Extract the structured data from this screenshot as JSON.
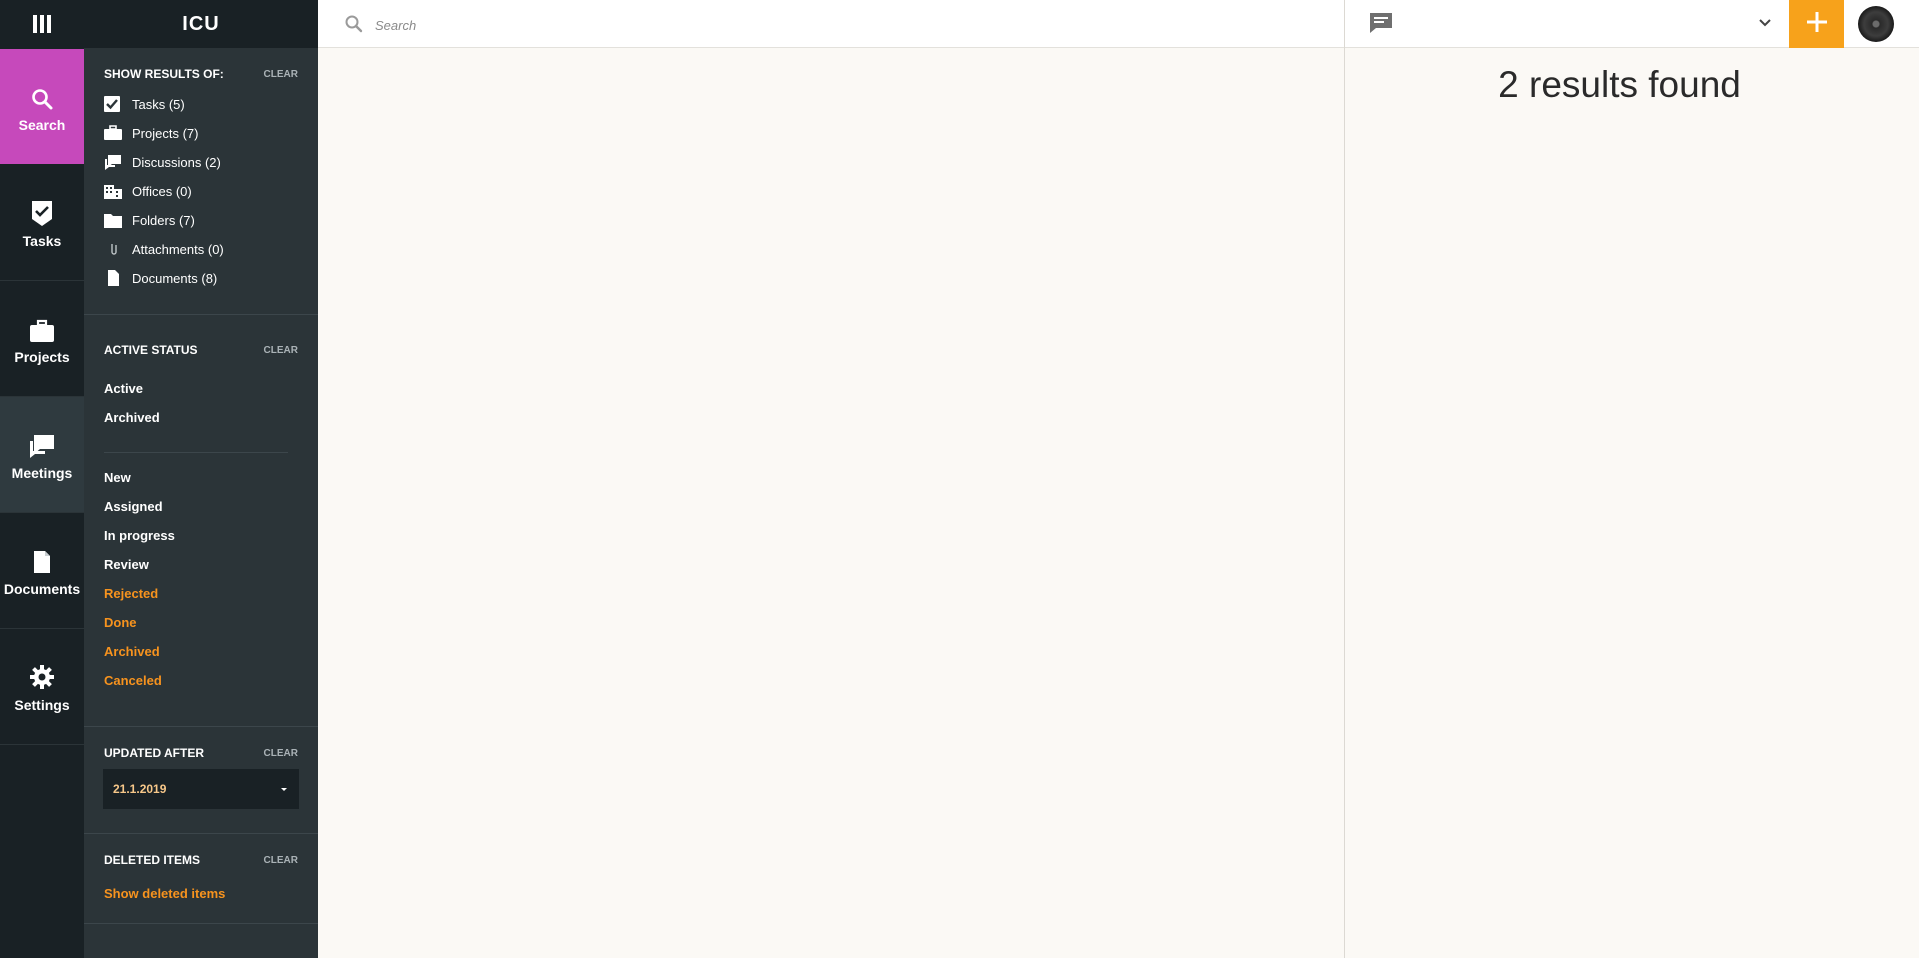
{
  "app": {
    "logo": "ICU"
  },
  "nav": {
    "items": [
      {
        "id": "search",
        "label": "Search",
        "icon": "search-icon"
      },
      {
        "id": "tasks",
        "label": "Tasks",
        "icon": "check-badge-icon"
      },
      {
        "id": "projects",
        "label": "Projects",
        "icon": "briefcase-icon"
      },
      {
        "id": "meetings",
        "label": "Meetings",
        "icon": "chat-bubbles-icon"
      },
      {
        "id": "documents",
        "label": "Documents",
        "icon": "document-icon"
      },
      {
        "id": "settings",
        "label": "Settings",
        "icon": "gear-icon"
      }
    ]
  },
  "filters": {
    "show_results": {
      "title": "SHOW RESULTS OF:",
      "clear": "CLEAR",
      "types": [
        {
          "label": "Tasks (5)",
          "icon": "checkbox-checked-icon"
        },
        {
          "label": "Projects (7)",
          "icon": "briefcase-icon"
        },
        {
          "label": "Discussions (2)",
          "icon": "chat-bubbles-icon"
        },
        {
          "label": "Offices (0)",
          "icon": "building-icon"
        },
        {
          "label": "Folders (7)",
          "icon": "folder-icon"
        },
        {
          "label": "Attachments (0)",
          "icon": "paperclip-icon"
        },
        {
          "label": "Documents (8)",
          "icon": "document-icon"
        }
      ]
    },
    "active_status": {
      "title": "ACTIVE STATUS",
      "clear": "CLEAR",
      "options": [
        "Active",
        "Archived"
      ],
      "statuses_white": [
        "New",
        "Assigned",
        "In progress",
        "Review"
      ],
      "statuses_orange": [
        "Rejected",
        "Done",
        "Archived",
        "Canceled"
      ]
    },
    "updated_after": {
      "title": "UPDATED AFTER",
      "clear": "CLEAR",
      "value": "21.1.2019"
    },
    "deleted": {
      "title": "DELETED ITEMS",
      "clear": "CLEAR",
      "link": "Show deleted items"
    }
  },
  "search": {
    "placeholder": "Search"
  },
  "results": {
    "title": "2 results found"
  },
  "colors": {
    "accent": "#f7a21b",
    "active_nav": "#c649bb",
    "orange_text": "#f7931e"
  }
}
